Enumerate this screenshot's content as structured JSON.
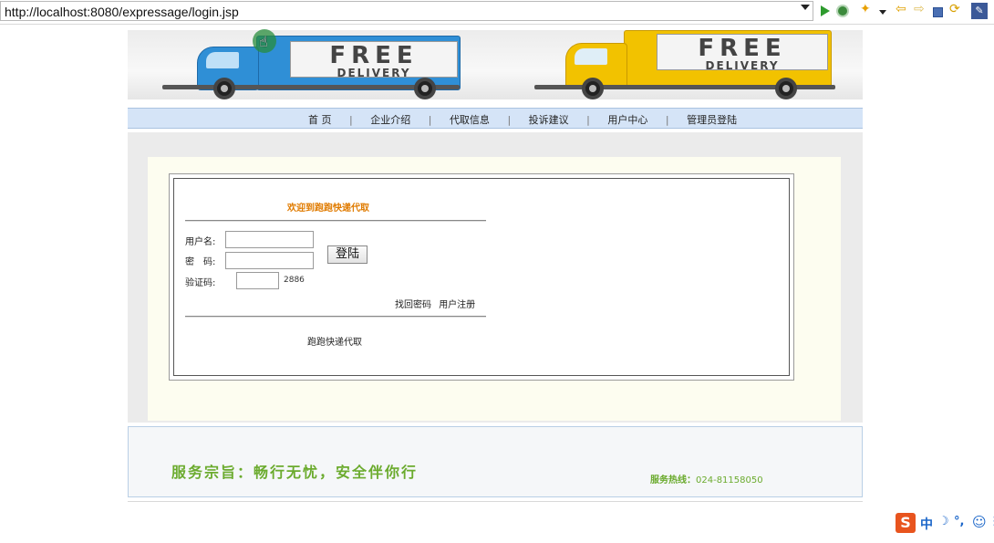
{
  "browser": {
    "url": "http://localhost:8080/expressage/login.jsp"
  },
  "banner": {
    "truck_left": {
      "line1": "FREE",
      "line2": "DELIVERY",
      "color": "#2f8fd6"
    },
    "truck_right": {
      "line1": "FREE",
      "line2": "DELIVERY",
      "color": "#f2c200"
    }
  },
  "nav": {
    "items": [
      "首 页",
      "企业介绍",
      "代取信息",
      "投诉建议",
      "用户中心",
      "管理员登陆"
    ],
    "separator": "|"
  },
  "login": {
    "welcome": "欢迎到跑跑快递代取",
    "username_label": "用户名:",
    "username_value": "",
    "password_label": "密　码:",
    "password_value": "",
    "captcha_label": "验证码:",
    "captcha_value": "",
    "captcha_code": "2886",
    "login_button": "登陆",
    "link_recover": "找回密码",
    "link_register": "用户注册",
    "footer_text": "跑跑快递代取"
  },
  "footer": {
    "motto": "服务宗旨：畅行无忧，安全伴你行",
    "hotline_label": "服务热线：",
    "hotline_number": "024-81158050"
  },
  "ime": {
    "logo": "S",
    "mode": "中",
    "moon": "☽",
    "punct": "°,",
    "emoji": "☺",
    "more": "⋮"
  },
  "colors": {
    "nav_bg": "#d5e4f7",
    "welcome": "#e07b00",
    "motto": "#6bab2e",
    "ime_logo": "#e8541e"
  }
}
